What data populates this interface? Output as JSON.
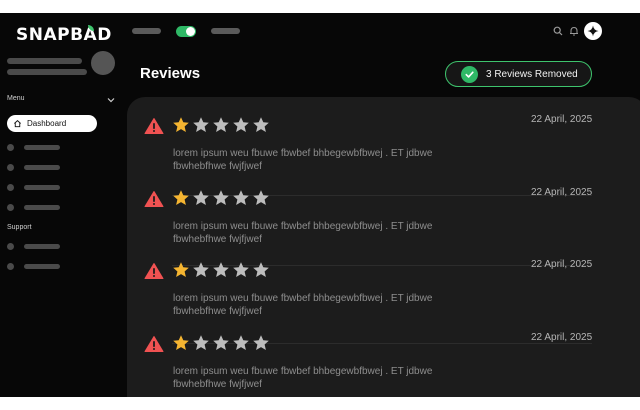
{
  "app": {
    "logo": "SNAPBAD"
  },
  "sidebar": {
    "menu_heading": "Menu",
    "dashboard_label": "Dashboard",
    "support_heading": "Support"
  },
  "page": {
    "title": "Reviews",
    "removed_badge": "3 Reviews Removed"
  },
  "reviews": [
    {
      "rating": 1,
      "max_rating": 5,
      "date": "22 April, 2025",
      "text": "lorem ipsum weu fbuwe fbwbef bhbegewbfbwej . ET jdbwe fbwhebfhwe fwjfjwef"
    },
    {
      "rating": 1,
      "max_rating": 5,
      "date": "22 April, 2025",
      "text": "lorem ipsum weu fbuwe fbwbef bhbegewbfbwej . ET jdbwe fbwhebfhwe fwjfjwef"
    },
    {
      "rating": 1,
      "max_rating": 5,
      "date": "22 April, 2025",
      "text": "lorem ipsum weu fbuwe fbwbef bhbegewbfbwej . ET jdbwe fbwhebfhwe fwjfjwef"
    },
    {
      "rating": 1,
      "max_rating": 5,
      "date": "22 April, 2025",
      "text": "lorem ipsum weu fbuwe fbwbef bhbegewbfbwej . ET jdbwe fbwhebfhwe fwjfjwef"
    }
  ],
  "icons": {
    "alert": "alert-triangle-icon",
    "star": "star-icon",
    "check": "check-circle-icon"
  },
  "colors": {
    "accent_green": "#3ec46d",
    "star_filled": "#f5b531",
    "star_empty": "#bdbdbd",
    "alert_red": "#f05252"
  }
}
